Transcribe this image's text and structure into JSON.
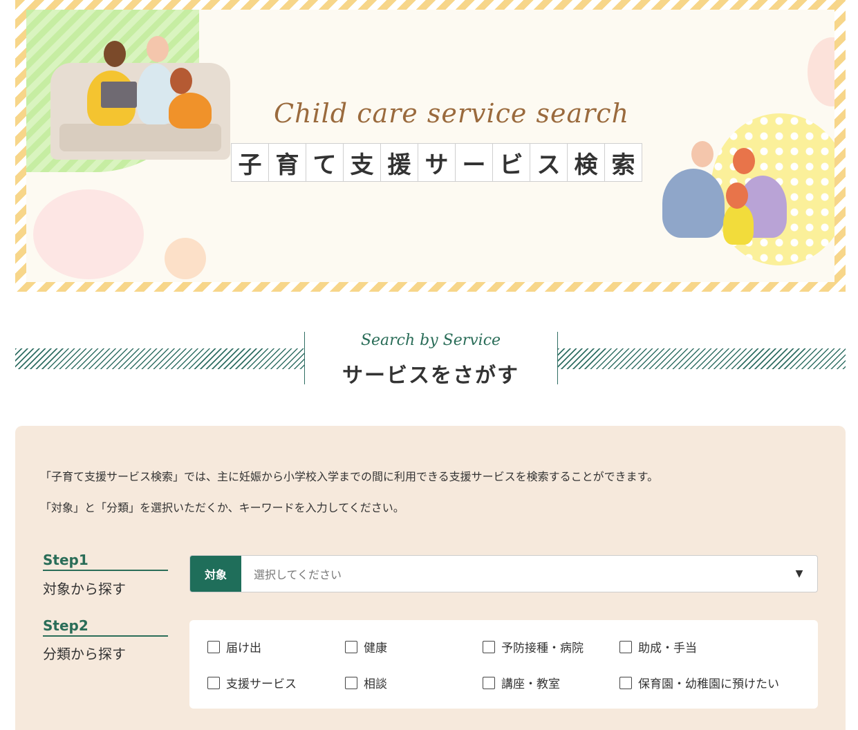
{
  "hero": {
    "title_en": "Child care service search",
    "title_chars": [
      "子",
      "育",
      "て",
      "支",
      "援",
      "サ",
      "ー",
      "ビ",
      "ス",
      "検",
      "索"
    ]
  },
  "section": {
    "subtitle": "Search by Service",
    "title": "サービスをさがす"
  },
  "intro": {
    "line1": "「子育て支援サービス検索」では、主に妊娠から小学校入学までの間に利用できる支援サービスを検索することができます。",
    "line2": "「対象」と「分類」を選択いただくか、キーワードを入力してください。"
  },
  "step1": {
    "label": "Step1",
    "title": "対象から探す",
    "select_tag": "対象",
    "select_value": "選択してください",
    "arrow": "▼"
  },
  "step2": {
    "label": "Step2",
    "title": "分類から探す",
    "categories": [
      "届け出",
      "健康",
      "予防接種・病院",
      "助成・手当",
      "支援サービス",
      "相談",
      "講座・教室",
      "保育園・幼稚園に預けたい"
    ]
  },
  "colors": {
    "accent_green": "#1f6e5a",
    "panel_bg": "#f6e9dc",
    "hero_stripe": "#f7d68a"
  }
}
